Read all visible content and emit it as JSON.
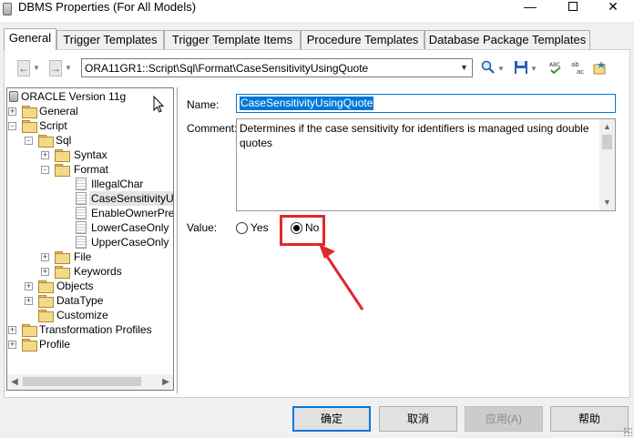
{
  "window": {
    "title": "DBMS Properties (For All Models)"
  },
  "tabs": [
    {
      "label": "General"
    },
    {
      "label": "Trigger Templates"
    },
    {
      "label": "Trigger Template Items"
    },
    {
      "label": "Procedure Templates"
    },
    {
      "label": "Database Package Templates"
    }
  ],
  "toolbar": {
    "back_label": "←",
    "forward_label": "→",
    "path": "ORA11GR1::Script\\Sql\\Format\\CaseSensitivityUsingQuote"
  },
  "tree": {
    "root": "ORACLE Version 11g",
    "items": [
      {
        "label": "General",
        "expander": "+"
      },
      {
        "label": "Script",
        "expander": "-"
      },
      {
        "label": "Sql",
        "expander": "-"
      },
      {
        "label": "Syntax",
        "expander": "+"
      },
      {
        "label": "Format",
        "expander": "-"
      },
      {
        "label": "IllegalChar"
      },
      {
        "label": "CaseSensitivityUsir"
      },
      {
        "label": "EnableOwnerPrefix"
      },
      {
        "label": "LowerCaseOnly"
      },
      {
        "label": "UpperCaseOnly"
      },
      {
        "label": "File",
        "expander": "+"
      },
      {
        "label": "Keywords",
        "expander": "+"
      },
      {
        "label": "Objects",
        "expander": "+"
      },
      {
        "label": "DataType",
        "expander": "+"
      },
      {
        "label": "Customize"
      },
      {
        "label": "Transformation Profiles",
        "expander": "+"
      },
      {
        "label": "Profile",
        "expander": "+"
      }
    ]
  },
  "detail": {
    "name_label": "Name:",
    "name_value": "CaseSensitivityUsingQuote",
    "comment_label": "Comment:",
    "comment_value": "Determines if the case sensitivity for identifiers is managed using double quotes",
    "value_label": "Value:",
    "radio_yes": "Yes",
    "radio_no": "No",
    "selected": "No"
  },
  "buttons": {
    "ok": "确定",
    "cancel": "取消",
    "apply": "应用(A)",
    "help": "帮助"
  },
  "colors": {
    "accent": "#0078d7",
    "annotation": "#e0282d"
  }
}
